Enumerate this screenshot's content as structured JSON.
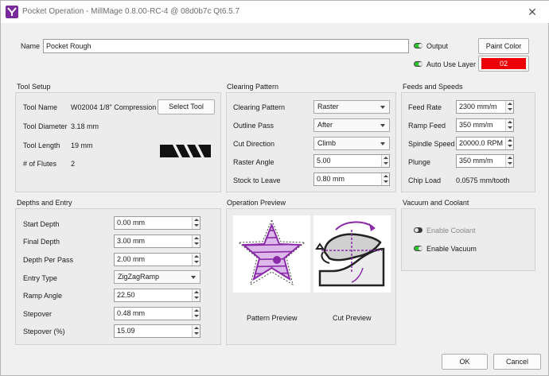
{
  "window": {
    "title": "Pocket Operation - MillMage 0.8.00-RC-4 @ 08d0b7c Qt6.5.7",
    "close_glyph": "✕"
  },
  "header": {
    "name_label": "Name",
    "name_value": "Pocket Rough",
    "output_label": "Output",
    "auto_use_layer_label": "Auto Use Layer",
    "paint_color_label": "Paint Color",
    "layer_value": "02",
    "layer_color": "#ee0000"
  },
  "tool_setup": {
    "title": "Tool Setup",
    "tool_name_label": "Tool Name",
    "tool_name_value": "W02004 1/8\" Compression",
    "select_tool_label": "Select Tool",
    "diameter_label": "Tool Diameter",
    "diameter_value": "3.18 mm",
    "length_label": "Tool Length",
    "length_value": "19 mm",
    "flutes_label": "# of Flutes",
    "flutes_value": "2",
    "tool_image_icon": "endmill-icon"
  },
  "clearing": {
    "title": "Clearing Pattern",
    "pattern_label": "Clearing Pattern",
    "pattern_value": "Raster",
    "outline_label": "Outline Pass",
    "outline_value": "After",
    "direction_label": "Cut Direction",
    "direction_value": "Climb",
    "raster_angle_label": "Raster Angle",
    "raster_angle_value": "5.00",
    "stock_label": "Stock to Leave",
    "stock_value": "0.80 mm"
  },
  "feeds": {
    "title": "Feeds and Speeds",
    "feed_label": "Feed Rate",
    "feed_value": "2300 mm/m",
    "ramp_label": "Ramp Feed",
    "ramp_value": "350 mm/m",
    "spindle_label": "Spindle Speed",
    "spindle_value": "20000.0 RPM",
    "plunge_label": "Plunge",
    "plunge_value": "350 mm/m",
    "chip_label": "Chip Load",
    "chip_value": "0.0575 mm/tooth"
  },
  "depths": {
    "title": "Depths and Entry",
    "start_label": "Start Depth",
    "start_value": "0.00 mm",
    "final_label": "Final Depth",
    "final_value": "3.00 mm",
    "per_pass_label": "Depth Per Pass",
    "per_pass_value": "2.00 mm",
    "entry_label": "Entry Type",
    "entry_value": "ZigZagRamp",
    "ramp_angle_label": "Ramp Angle",
    "ramp_angle_value": "22.50",
    "stepover_label": "Stepover",
    "stepover_value": "0.48 mm",
    "stepover_pct_label": "Stepover (%)",
    "stepover_pct_value": "15.09"
  },
  "preview": {
    "title": "Operation Preview",
    "pattern_caption": "Pattern Preview",
    "cut_caption": "Cut Preview",
    "accent": "#8a2aa8"
  },
  "vacuum": {
    "title": "Vacuum and Coolant",
    "coolant_label": "Enable Coolant",
    "coolant_on": false,
    "vacuum_label": "Enable Vacuum",
    "vacuum_on": true
  },
  "footer": {
    "ok_label": "OK",
    "cancel_label": "Cancel"
  }
}
